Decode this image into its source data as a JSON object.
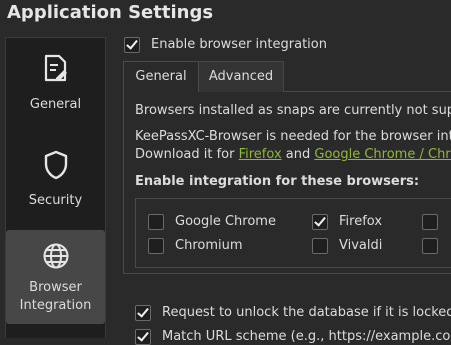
{
  "window": {
    "title": "Application Settings"
  },
  "sidebar": {
    "items": [
      {
        "label": "General",
        "icon": "document-edit-icon"
      },
      {
        "label": "Security",
        "icon": "shield-icon"
      },
      {
        "label": "Browser Integration",
        "label_line1": "Browser",
        "label_line2": "Integration",
        "icon": "globe-icon",
        "active": true
      }
    ]
  },
  "main": {
    "enable_integration": {
      "label": "Enable browser integration",
      "checked": true
    },
    "tabs": [
      {
        "label": "General",
        "active": true
      },
      {
        "label": "Advanced",
        "active": false
      }
    ],
    "snaps_notice": "Browsers installed as snaps are currently not suppo",
    "keepassxc_notice": "KeePassXC-Browser is needed for the browser integ",
    "download": {
      "prefix": "Download it for ",
      "firefox_link": "Firefox",
      "and": " and ",
      "chrome_link": "Google Chrome / Chrom"
    },
    "browsers_heading": "Enable integration for these browsers:",
    "browsers": [
      {
        "label": "Google Chrome",
        "checked": false
      },
      {
        "label": "Firefox",
        "checked": true
      },
      {
        "label": "Chromium",
        "checked": false
      },
      {
        "label": "Vivaldi",
        "checked": false
      }
    ],
    "options": [
      {
        "label": "Request to unlock the database if it is locked",
        "checked": true
      },
      {
        "label": "Match URL scheme (e.g., https://example.com)",
        "checked": true
      }
    ]
  },
  "colors": {
    "background": "#2a2a2a",
    "sidebar": "#1e1e1e",
    "active_item": "#474747",
    "link": "#8fb83a"
  }
}
